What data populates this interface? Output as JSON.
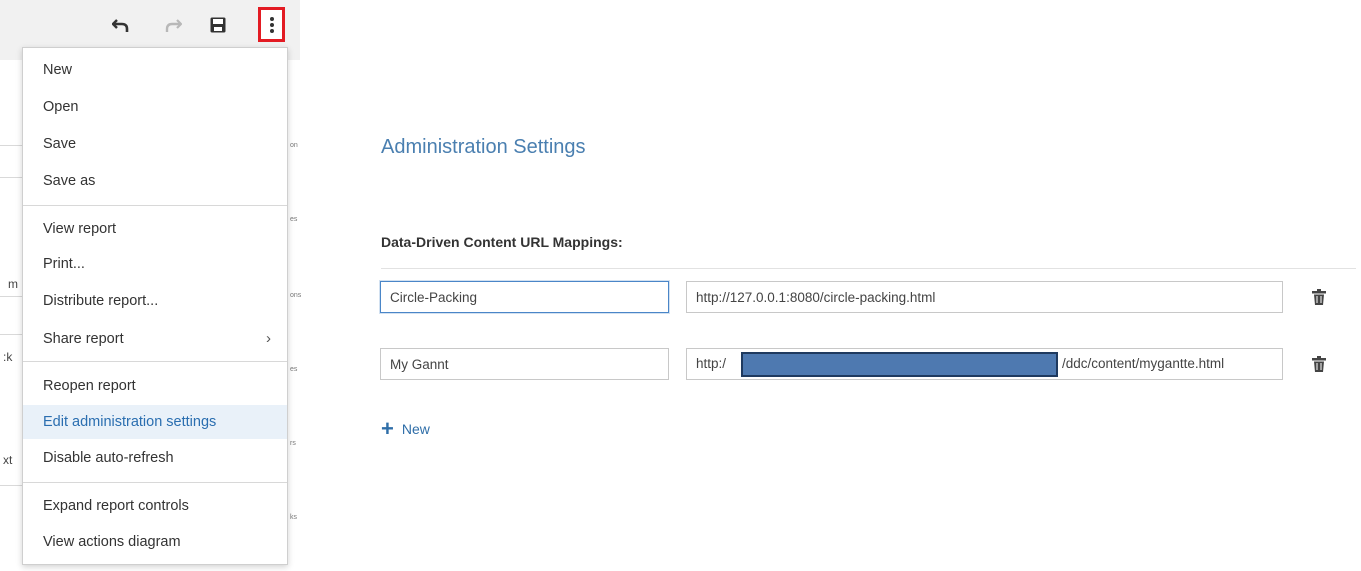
{
  "toolbar": {
    "undo_icon": "undo-icon",
    "redo_icon": "redo-icon",
    "save_icon": "save-icon",
    "more_icon": "more-vertical-icon"
  },
  "background": {
    "frag_m": "m",
    "frag_k": ":k",
    "frag_xt": "xt",
    "mini_1": "on",
    "mini_2": "es",
    "mini_3": "ons",
    "mini_4": "es",
    "mini_5": "rs",
    "mini_6": "ks"
  },
  "menu": {
    "items": [
      {
        "label": "New"
      },
      {
        "label": "Open"
      },
      {
        "label": "Save"
      },
      {
        "label": "Save as"
      },
      {
        "label": "View report"
      },
      {
        "label": "Print..."
      },
      {
        "label": "Distribute report..."
      },
      {
        "label": "Share report",
        "submenu": "›"
      },
      {
        "label": "Reopen report"
      },
      {
        "label": "Edit administration settings"
      },
      {
        "label": "Disable auto-refresh"
      },
      {
        "label": "Expand report controls"
      },
      {
        "label": "View actions diagram"
      }
    ]
  },
  "admin": {
    "title": "Administration Settings",
    "section_label": "Data-Driven Content URL Mappings:",
    "mappings": [
      {
        "name": "Circle-Packing",
        "url": "http://127.0.0.1:8080/circle-packing.html"
      },
      {
        "name": "My Gannt",
        "url_prefix": "http:/",
        "url_suffix": "/ddc/content/mygantte.html"
      }
    ],
    "new_label": "New",
    "delete_icon": "trash-icon",
    "add_icon": "plus-icon"
  },
  "colors": {
    "accent": "#2f6ea8",
    "highlight_box": "#e31b23",
    "menu_active_bg": "#e9f1f9",
    "redaction": "#4e79b0"
  }
}
